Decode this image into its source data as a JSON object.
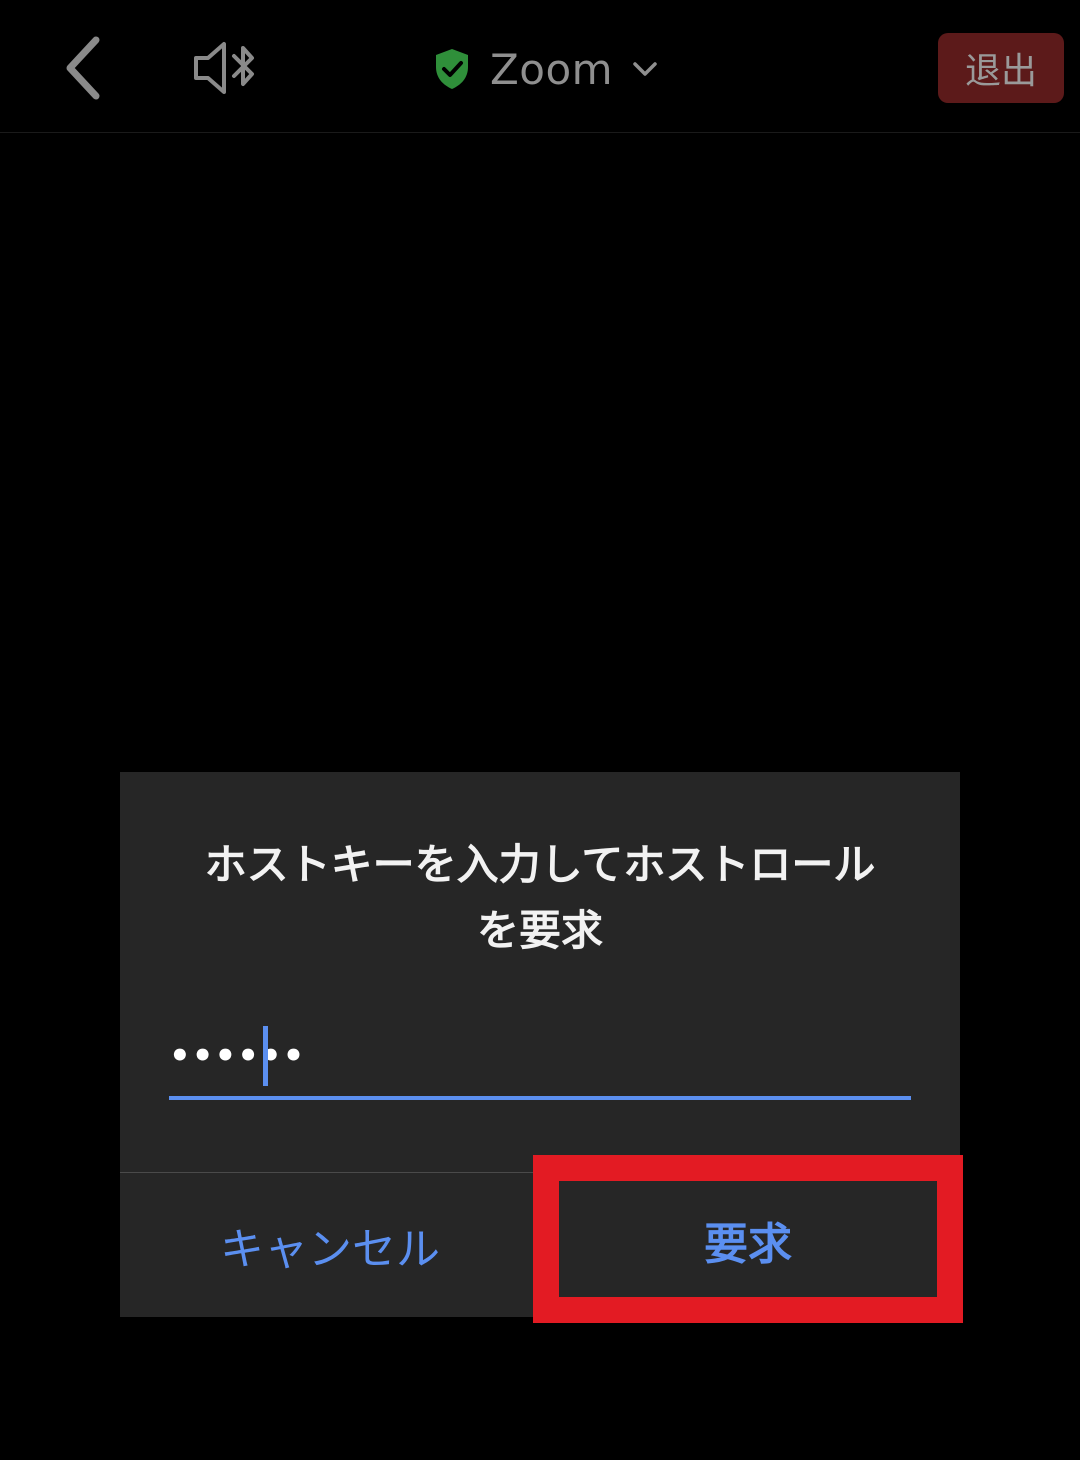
{
  "topbar": {
    "meeting_title": "Zoom",
    "leave_label": "退出",
    "icons": {
      "back": "chevron-left-icon",
      "audio": "speaker-bluetooth-icon",
      "security": "shield-check-icon",
      "dropdown": "chevron-down-icon"
    },
    "colors": {
      "shield": "#2f8f3a",
      "leave_bg": "#5c1a1a"
    }
  },
  "dialog": {
    "title_line1": "ホストキーを入力してホストロール",
    "title_line2": "を要求",
    "key_value": "••••••",
    "cancel_label": "キャンセル",
    "request_label": "要求",
    "colors": {
      "accent": "#5b8ff0",
      "background": "#262626"
    }
  },
  "annotation": {
    "highlight_color": "#e31b23"
  }
}
